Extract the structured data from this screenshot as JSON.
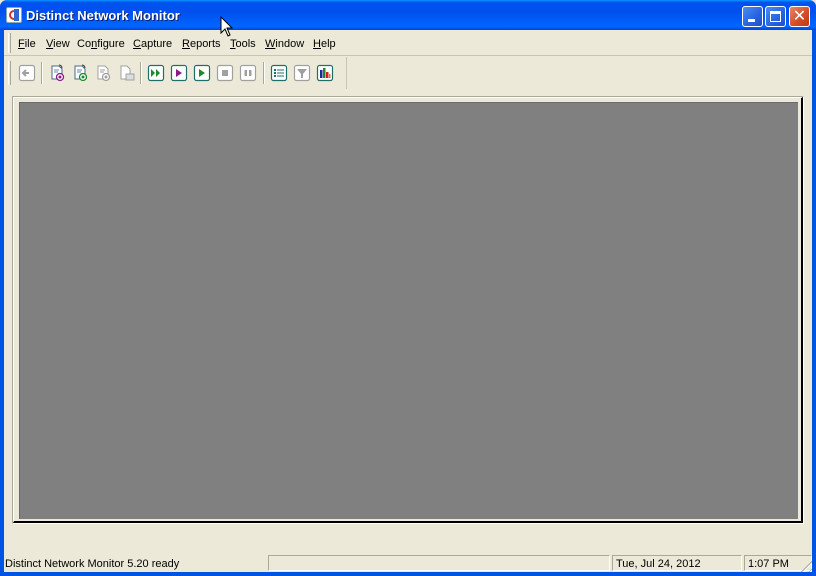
{
  "window": {
    "title": "Distinct Network Monitor",
    "controls": {
      "minimize": "minimize",
      "maximize": "maximize",
      "close": "close"
    }
  },
  "menubar": {
    "items": [
      {
        "label": "File",
        "accel": "F",
        "rest": "ile"
      },
      {
        "label": "View",
        "accel": "V",
        "rest": "iew"
      },
      {
        "label": "Configure",
        "pre": "Co",
        "accel": "n",
        "rest": "figure"
      },
      {
        "label": "Capture",
        "accel": "C",
        "rest": "apture"
      },
      {
        "label": "Reports",
        "accel": "R",
        "rest": "eports"
      },
      {
        "label": "Tools",
        "accel": "T",
        "rest": "ools"
      },
      {
        "label": "Window",
        "accel": "W",
        "rest": "indow"
      },
      {
        "label": "Help",
        "accel": "H",
        "rest": "elp"
      }
    ]
  },
  "toolbar": {
    "buttons": [
      {
        "name": "back",
        "icon": "back-arrow-icon",
        "enabled": false
      },
      {
        "name": "open-capture-purple",
        "icon": "document-capture-icon",
        "enabled": true
      },
      {
        "name": "open-capture-green",
        "icon": "document-capture-icon",
        "enabled": true
      },
      {
        "name": "document-disabled",
        "icon": "document-icon",
        "enabled": false
      },
      {
        "name": "save-disabled",
        "icon": "save-document-icon",
        "enabled": false
      },
      {
        "name": "start-capture-all",
        "icon": "fast-forward-icon",
        "enabled": true
      },
      {
        "name": "start-capture-purple",
        "icon": "play-icon",
        "enabled": true
      },
      {
        "name": "start-capture-green",
        "icon": "play-icon",
        "enabled": true
      },
      {
        "name": "stop-capture",
        "icon": "stop-icon",
        "enabled": false
      },
      {
        "name": "pause-capture",
        "icon": "pause-icon",
        "enabled": false
      },
      {
        "name": "list-view",
        "icon": "list-icon",
        "enabled": true
      },
      {
        "name": "filter",
        "icon": "filter-icon",
        "enabled": false
      },
      {
        "name": "statistics",
        "icon": "bar-chart-icon",
        "enabled": true
      }
    ],
    "colors": {
      "frame": "#1e6f6a",
      "purple": "#8a1a8a",
      "green": "#1a8a2a",
      "disabled": "#a0a0a0"
    }
  },
  "statusbar": {
    "message": "Distinct Network Monitor 5.20 ready",
    "pane_empty": "",
    "date": "Tue, Jul 24, 2012",
    "time": "1:07 PM"
  }
}
